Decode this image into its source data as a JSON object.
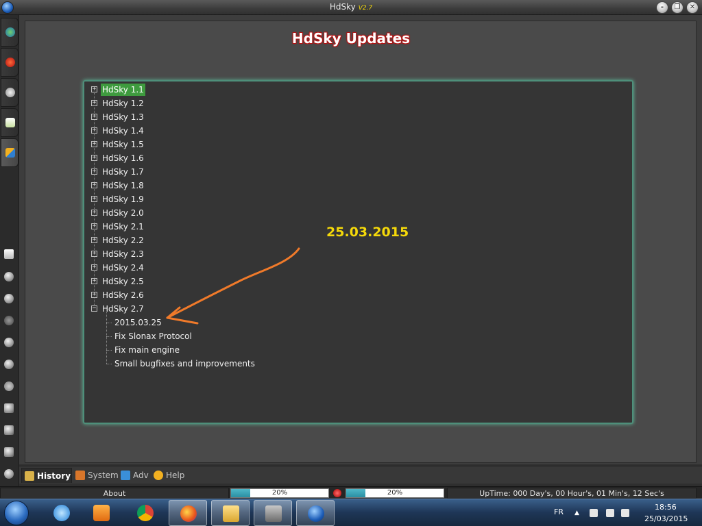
{
  "window": {
    "title": "HdSky",
    "version": "V2.7",
    "buttons": [
      "-",
      "❐",
      "✕"
    ]
  },
  "page": {
    "title": "HdSky Updates",
    "annotation_date": "25.03.2015"
  },
  "tree": {
    "versions": [
      "HdSky 1.1",
      "HdSky 1.2",
      "HdSky 1.3",
      "HdSky 1.4",
      "HdSky 1.5",
      "HdSky 1.6",
      "HdSky 1.7",
      "HdSky 1.8",
      "HdSky 1.9",
      "HdSky 2.0",
      "HdSky 2.1",
      "HdSky 2.2",
      "HdSky 2.3",
      "HdSky 2.4",
      "HdSky 2.5",
      "HdSky 2.6",
      "HdSky 2.7"
    ],
    "selected": "HdSky 1.1",
    "expanded": "HdSky 2.7",
    "children": [
      "2015.03.25",
      "Fix Slonax Protocol",
      "Fix main engine",
      "Small bugfixes and improvements"
    ]
  },
  "bottom_tabs": [
    {
      "label": "History",
      "active": true,
      "color": "#d9b24a"
    },
    {
      "label": "System",
      "active": false,
      "color": "#d9762a"
    },
    {
      "label": "Adv",
      "active": false,
      "color": "#3a8fd8"
    },
    {
      "label": "Help",
      "active": false,
      "color": "#f2b020"
    }
  ],
  "status": {
    "about": "About",
    "bar1_text": "20%",
    "bar1_progress": 0.2,
    "bar2_text": "20%",
    "bar2_progress": 0.2,
    "uptime": "UpTime: 000 Day's, 00 Hour's, 01 Min's, 12 Sec's"
  },
  "taskbar": {
    "lang": "FR",
    "time": "18:56",
    "date": "25/03/2015",
    "apps": [
      "internet-explorer",
      "media-player",
      "chrome",
      "firefox",
      "file-explorer",
      "e2-app",
      "hdsky-app"
    ]
  },
  "colors": {
    "accent_green": "#3e9b3e",
    "annotation_yellow": "#f5d90a",
    "arrow_orange": "#f07a2a",
    "title_glow": "#b01515"
  }
}
